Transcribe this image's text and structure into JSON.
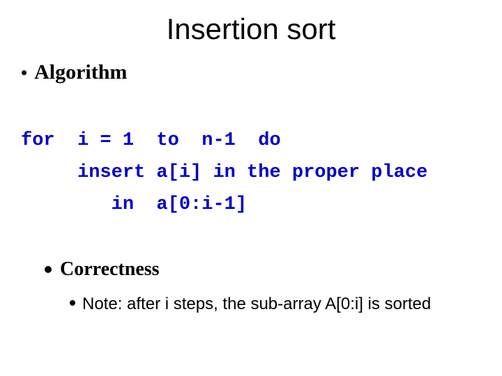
{
  "title": "Insertion sort",
  "bullets": {
    "algorithm_label": "Algorithm",
    "correctness_label": "Correctness"
  },
  "code": {
    "line1": "for  i = 1  to  n-1  do",
    "line2": "     insert a[i] in the proper place",
    "line3": "        in  a[0:i-1]"
  },
  "note": "Note: after i steps, the sub-array A[0:i] is sorted"
}
